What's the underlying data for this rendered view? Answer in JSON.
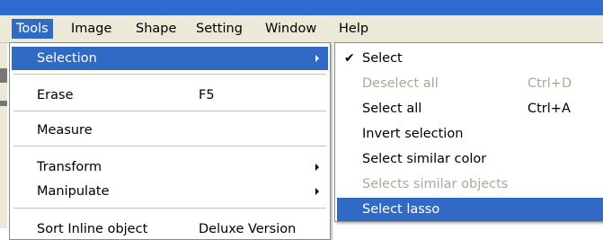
{
  "menubar": {
    "items": [
      {
        "label": "Tools",
        "active": true
      },
      {
        "label": "Image"
      },
      {
        "label": "Shape"
      },
      {
        "label": "Setting"
      },
      {
        "label": "Window"
      },
      {
        "label": "Help"
      }
    ]
  },
  "tools_menu": {
    "items": [
      {
        "label": "Selection",
        "submenu": true,
        "highlighted": true
      },
      {
        "label": "Erase",
        "shortcut": "F5"
      },
      {
        "label": "Measure"
      },
      {
        "label": "Transform",
        "submenu": true
      },
      {
        "label": "Manipulate",
        "submenu": true
      },
      {
        "label": "Sort Inline object",
        "shortcut": "Deluxe Version"
      }
    ]
  },
  "selection_submenu": {
    "items": [
      {
        "label": "Select",
        "checked": true
      },
      {
        "label": "Deselect all",
        "shortcut": "Ctrl+D",
        "disabled": true
      },
      {
        "label": "Select all",
        "shortcut": "Ctrl+A"
      },
      {
        "label": "Invert selection"
      },
      {
        "label": "Select similar color"
      },
      {
        "label": "Selects similar objects",
        "disabled": true
      },
      {
        "label": "Select lasso",
        "highlighted": true
      }
    ]
  },
  "icons": {
    "check": "checkmark-icon",
    "submenu_arrow": "triangle-right-icon"
  },
  "colors": {
    "highlight": "#316ac5",
    "menubar": "#ece9d8",
    "disabled_text": "#aca899",
    "titlebar": "#2f6ad0"
  }
}
